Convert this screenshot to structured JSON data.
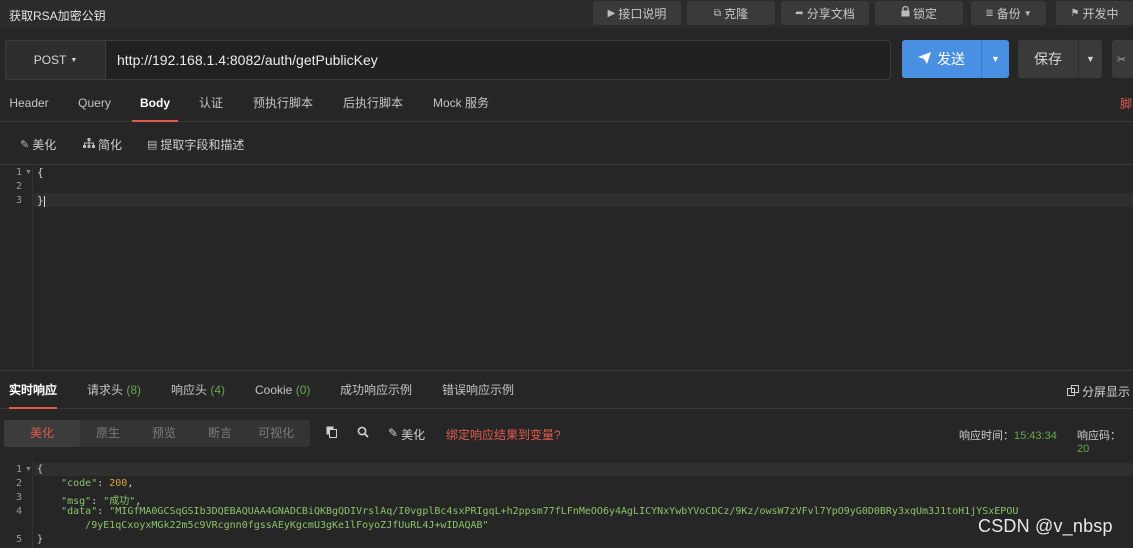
{
  "window": {
    "title": "获取RSA加密公钥"
  },
  "topbar": {
    "buttons": [
      {
        "label": "接口说明",
        "icon": "play-icon"
      },
      {
        "label": "克隆",
        "icon": "clone-icon"
      },
      {
        "label": "分享文档",
        "icon": "share-icon"
      },
      {
        "label": "锁定",
        "icon": "lock-icon"
      },
      {
        "label": "备份",
        "icon": "database-icon"
      },
      {
        "label": "开发中",
        "icon": "flag-icon"
      }
    ]
  },
  "request": {
    "method": "POST",
    "url": "http://192.168.1.4:8082/auth/getPublicKey",
    "send_label": "发送",
    "save_label": "保存"
  },
  "request_tabs": {
    "items": [
      "Header",
      "Query",
      "Body",
      "认证",
      "预执行脚本",
      "后执行脚本",
      "Mock 服务"
    ],
    "active": "Body",
    "edge_text": "脚"
  },
  "body_tools": {
    "beautify": "美化",
    "simplify": "简化",
    "extract": "提取字段和描述"
  },
  "editor": {
    "line_numbers": [
      "1",
      "2",
      "3"
    ],
    "lines": [
      "{",
      "",
      "}"
    ]
  },
  "response_tabs": {
    "items": [
      {
        "label": "实时响应",
        "count": ""
      },
      {
        "label": "请求头",
        "count": "(8)"
      },
      {
        "label": "响应头",
        "count": "(4)"
      },
      {
        "label": "Cookie",
        "count": "(0)"
      },
      {
        "label": "成功响应示例",
        "count": ""
      },
      {
        "label": "错误响应示例",
        "count": ""
      }
    ],
    "active": "实时响应",
    "fullscreen": "分屏显示"
  },
  "response_tools": {
    "segments": [
      "美化",
      "原生",
      "预览",
      "断言",
      "可视化"
    ],
    "active_segment": "美化",
    "beautify": "美化",
    "bind_link": "绑定响应结果到变量?",
    "time_label": "响应时间：",
    "time_value": "15:43:34",
    "code_label": "响应码：",
    "code_value": "20"
  },
  "response": {
    "line_numbers": [
      "1",
      "2",
      "3",
      "4",
      "",
      "5"
    ],
    "open": "{",
    "code_key": "\"code\"",
    "code_val": "200",
    "msg_key": "\"msg\"",
    "msg_val": "\"成功\"",
    "data_key": "\"data\"",
    "data_val_1": "\"MIGfMA0GCSqGSIb3DQEBAQUAA4GNADCBiQKBgQDIVrslAq/I0vgplBc4sxPRIgqL+h2ppsm77fLFnMeOO6y4AgLICYNxYwbYVoCDCz/9Kz/owsW7zVFvl7YpO9yG0D0BRy3xqUm3J1toH1jYSxEPOU",
    "data_val_2": "/9yE1qCxoyxMGk22m5c9VRcgnn0fgssAEyKgcmU3gKe1lFoyoZJfUuRL4J+wIDAQAB\"",
    "close": "}"
  },
  "watermark": "CSDN @v_nbsp",
  "colors": {
    "accent": "#e05a4f",
    "primary": "#4a90e2",
    "success": "#6aa84f"
  }
}
